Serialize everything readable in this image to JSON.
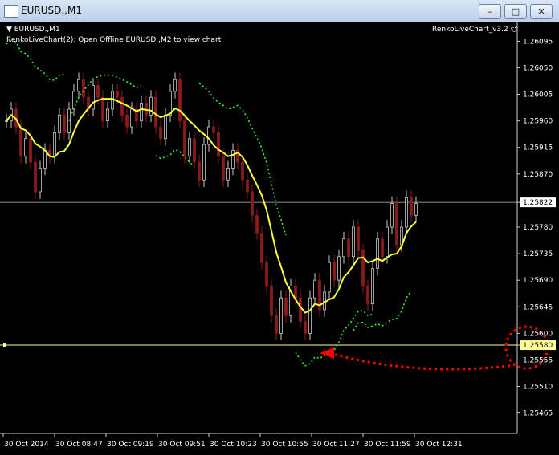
{
  "window": {
    "title": "EURUSD.,M1"
  },
  "chart": {
    "header_symbol": "EURUSD.,M1",
    "info_text": "RenkoLiveChart(2): Open Offline EURUSD.,M2 to view chart",
    "indicator_name": "RenkoLiveChart_v3.2",
    "current_price": "1.25822",
    "line_price": "1.25580",
    "price_labels": [
      "1.26095",
      "1.26050",
      "1.26005",
      "1.25960",
      "1.25915",
      "1.25870",
      "1.25822",
      "1.25780",
      "1.25735",
      "1.25690",
      "1.25645",
      "1.25600",
      "1.25580",
      "1.25555",
      "1.25510",
      "1.25465"
    ],
    "time_labels": [
      "30 Oct 2014",
      "30 Oct 08:47",
      "30 Oct 09:19",
      "30 Oct 09:51",
      "30 Oct 10:23",
      "30 Oct 10:55",
      "30 Oct 11:27",
      "30 Oct 11:59",
      "30 Oct 12:31"
    ],
    "colors": {
      "bull": "#c8c8c8",
      "bear": "#8b1a1a",
      "ma": "#ffff33",
      "bands": "#33ff33",
      "annotation": "#ff0000",
      "hline": "#ffff99"
    }
  },
  "chart_data": {
    "type": "candlestick",
    "y_range": [
      1.2544,
      1.2612
    ],
    "closes": [
      1.2596,
      1.2598,
      1.2595,
      1.259,
      1.2593,
      1.2589,
      1.2584,
      1.2588,
      1.2591,
      1.259,
      1.2594,
      1.2597,
      1.2594,
      1.2598,
      1.2601,
      1.2603,
      1.26,
      1.2598,
      1.2602,
      1.26,
      1.2596,
      1.2598,
      1.2601,
      1.26,
      1.2597,
      1.2595,
      1.2598,
      1.2596,
      1.2599,
      1.2597,
      1.26,
      1.2595,
      1.2593,
      1.2597,
      1.2601,
      1.2603,
      1.2596,
      1.259,
      1.2593,
      1.2589,
      1.2586,
      1.2592,
      1.2595,
      1.2594,
      1.259,
      1.2586,
      1.2588,
      1.2591,
      1.2589,
      1.2586,
      1.2584,
      1.258,
      1.2577,
      1.2572,
      1.2568,
      1.2563,
      1.256,
      1.2566,
      1.2563,
      1.2568,
      1.2566,
      1.2562,
      1.256,
      1.2566,
      1.2569,
      1.2564,
      1.2567,
      1.2572,
      1.2569,
      1.2573,
      1.2576,
      1.2573,
      1.2578,
      1.2574,
      1.2568,
      1.2565,
      1.2571,
      1.2576,
      1.2573,
      1.2578,
      1.2582,
      1.2575,
      1.2578,
      1.2583,
      1.258,
      1.2582
    ]
  }
}
